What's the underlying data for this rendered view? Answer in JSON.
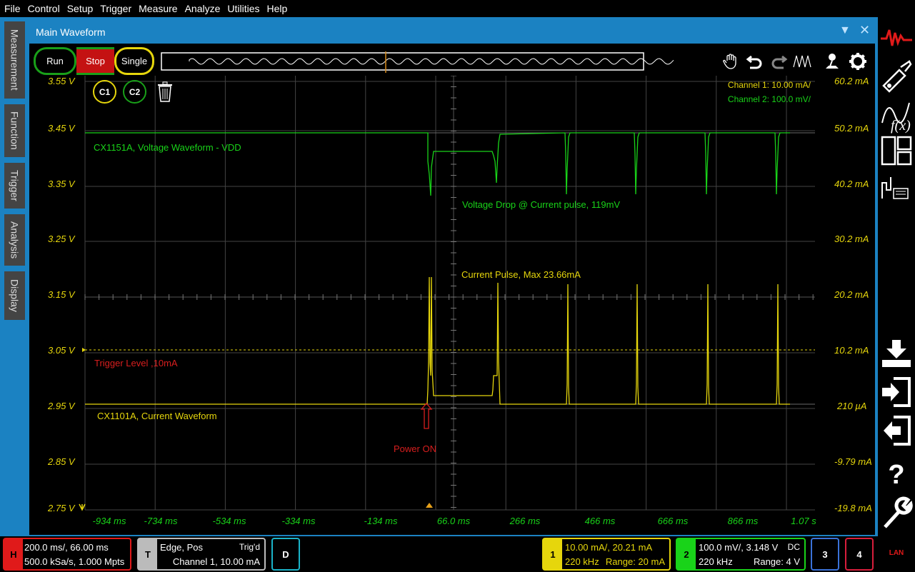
{
  "menu": [
    "File",
    "Control",
    "Setup",
    "Trigger",
    "Measure",
    "Analyze",
    "Utilities",
    "Help"
  ],
  "side_tabs": [
    "Measurement",
    "Function",
    "Trigger",
    "Analysis",
    "Display"
  ],
  "window": {
    "title": "Main Waveform"
  },
  "controls": {
    "run": "Run",
    "stop": "Stop",
    "single": "Single"
  },
  "markers": {
    "c1": "C1",
    "c2": "C2"
  },
  "scale_info": {
    "ch1": "Channel 1:  10.00 mA/",
    "ch2": "Channel 2:  100.0 mV/"
  },
  "left_axis": [
    "3.55 V",
    "3.45 V",
    "3.35 V",
    "3.25 V",
    "3.15 V",
    "3.05 V",
    "2.95 V",
    "2.85 V",
    "2.75 V"
  ],
  "right_axis": [
    "60.2 mA",
    "50.2 mA",
    "40.2 mA",
    "30.2 mA",
    "20.2 mA",
    "10.2 mA",
    "210 µA",
    "-9.79 mA",
    "-19.8 mA"
  ],
  "x_axis": [
    "-934 ms",
    "-734 ms",
    "-534 ms",
    "-334 ms",
    "-134 ms",
    "66.0 ms",
    "266 ms",
    "466 ms",
    "666 ms",
    "866 ms",
    "1.07 s"
  ],
  "annotations": {
    "voltage_label": "CX1151A, Voltage Waveform - VDD",
    "voltage_drop": "Voltage Drop @ Current pulse,  119mV",
    "current_pulse": "Current Pulse, Max 23.66mA",
    "trigger_level": "Trigger Level ,10mA",
    "current_label": "CX1101A, Current Waveform",
    "power_on": "Power ON"
  },
  "status": {
    "h": {
      "tag": "H",
      "l1": "200.0 ms/, 66.00 ms",
      "l2": "500.0 kSa/s, 1.000 Mpts"
    },
    "t": {
      "tag": "T",
      "l1": "Edge, Pos",
      "r1": "Trig'd",
      "l2": "Channel 1, 10.00 mA"
    },
    "d": {
      "tag": "D"
    },
    "ch1": {
      "tag": "1",
      "l1": "10.00 mA/, 20.21 mA",
      "l2": "220 kHz",
      "r2": "Range: 20 mA"
    },
    "ch2": {
      "tag": "2",
      "l1": "100.0 mV/, 3.148 V",
      "r1": "DC",
      "l2": "220 kHz",
      "r2": "Range: 4 V"
    },
    "ch3": {
      "tag": "3"
    },
    "ch4": {
      "tag": "4"
    },
    "lan": "LAN"
  },
  "colors": {
    "ch1": "#e6d60c",
    "ch2": "#19d319",
    "frame": "#1b82c2",
    "stop": "#c41212",
    "trigger_text": "#d81e1e"
  }
}
